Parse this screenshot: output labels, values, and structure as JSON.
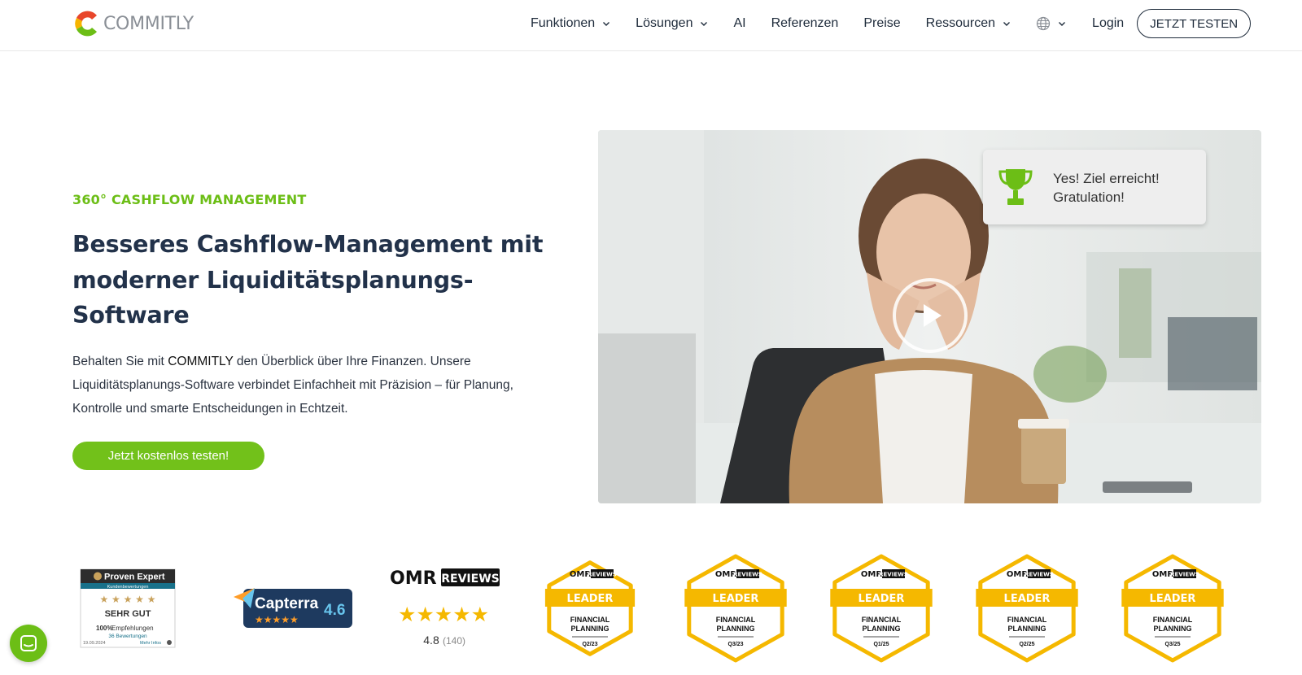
{
  "brand": {
    "name": "COMMITLY"
  },
  "nav": {
    "items": [
      {
        "label": "Funktionen",
        "dropdown": true
      },
      {
        "label": "Lösungen",
        "dropdown": true
      },
      {
        "label": "AI",
        "dropdown": false
      },
      {
        "label": "Referenzen",
        "dropdown": false
      },
      {
        "label": "Preise",
        "dropdown": false
      },
      {
        "label": "Ressourcen",
        "dropdown": true
      }
    ],
    "language_icon": "globe-icon",
    "login": "Login",
    "cta": "JETZT TESTEN"
  },
  "hero": {
    "eyebrow": "360° CASHFLOW MANAGEMENT",
    "headline_l1": "Besseres Cashflow-Management mit",
    "headline_l2": "moderner Liquiditätsplanungs-",
    "headline_l3": "Software",
    "body_pre": "Behalten Sie mit ",
    "body_brand": "COMMITLY",
    "body_post": " den Überblick über Ihre Finanzen. Unsere Liquiditätsplanungs-Software verbindet Einfachheit mit Präzision – für Planung, Kontrolle und smarte Entscheidungen in Echtzeit.",
    "cta": "Jetzt kostenlos testen!"
  },
  "video": {
    "toast_line1": "Yes! Ziel erreicht!",
    "toast_line2": "Gratulation!",
    "play_icon": "play-icon"
  },
  "badges": {
    "proven_expert": {
      "brand": "Proven Expert",
      "subtitle": "Kundenbewertungen",
      "verdict": "SEHR GUT",
      "recommend_pct": "100%",
      "recommend_text": "Empfehlungen",
      "reviews": "36 Bewertungen",
      "date": "19.09.2024",
      "more": "Mehr Infos",
      "stars": 4.5
    },
    "capterra": {
      "brand": "Capterra",
      "score": "4.6",
      "stars": 4.5
    },
    "omr": {
      "brand_a": "OMR",
      "brand_b": "REVIEWS",
      "score": "4.8",
      "count": "(140)",
      "stars": 5
    },
    "leaders": [
      {
        "title": "LEADER",
        "category_l1": "FINANCIAL",
        "category_l2": "PLANNING",
        "period": "Q2/23"
      },
      {
        "title": "LEADER",
        "category_l1": "FINANCIAL",
        "category_l2": "PLANNING",
        "period": "Q3/23"
      },
      {
        "title": "LEADER",
        "category_l1": "FINANCIAL",
        "category_l2": "PLANNING",
        "period": "Q1/25"
      },
      {
        "title": "LEADER",
        "category_l1": "FINANCIAL",
        "category_l2": "PLANNING",
        "period": "Q2/25"
      },
      {
        "title": "LEADER",
        "category_l1": "FINANCIAL",
        "category_l2": "PLANNING",
        "period": "Q3/25"
      }
    ]
  },
  "chat": {
    "icon": "chat-icon"
  },
  "colors": {
    "accent_green": "#72c11a",
    "navy": "#22324a",
    "gold": "#f5b800",
    "capterra_navy": "#1e3a5f"
  }
}
